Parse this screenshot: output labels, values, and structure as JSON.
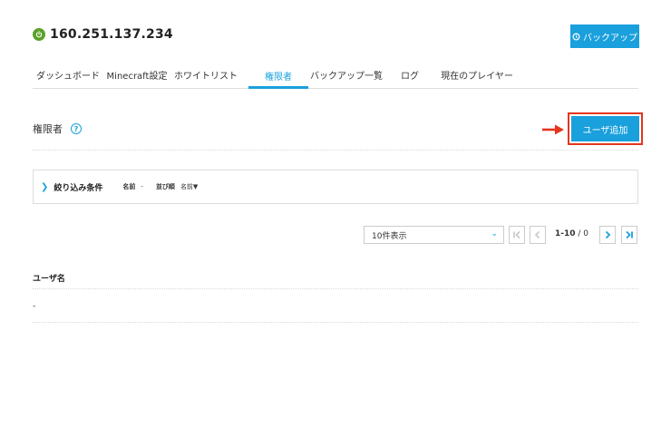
{
  "server": {
    "ip": "160.251.137.234",
    "status_icon": "power-icon",
    "status_color": "#5ca12a"
  },
  "backup_button": {
    "label": "バックアップ",
    "icon": "backup-icon"
  },
  "tabs": [
    {
      "label": "ダッシュボード",
      "active": false
    },
    {
      "label": "Minecraft設定",
      "active": false
    },
    {
      "label": "ホワイトリスト",
      "active": false
    },
    {
      "label": "権限者",
      "active": true
    },
    {
      "label": "バックアップ一覧",
      "active": false
    },
    {
      "label": "ログ",
      "active": false
    },
    {
      "label": "現在のプレイヤー",
      "active": false
    }
  ],
  "section": {
    "title": "権限者",
    "help_icon": "question-icon"
  },
  "add_user_button": {
    "label": "ユーザ追加"
  },
  "filter": {
    "title": "絞り込み条件",
    "name_label": "名前",
    "name_value": "-",
    "sort_label": "並び順",
    "sort_value": "名前▼"
  },
  "pagination": {
    "per_page": "10件表示",
    "range": "1-10",
    "separator": " / ",
    "total": "0"
  },
  "table": {
    "columns": [
      "ユーザ名"
    ],
    "rows": [
      [
        "-"
      ]
    ]
  },
  "colors": {
    "accent": "#1aa0dc",
    "highlight": "#e5351d"
  }
}
